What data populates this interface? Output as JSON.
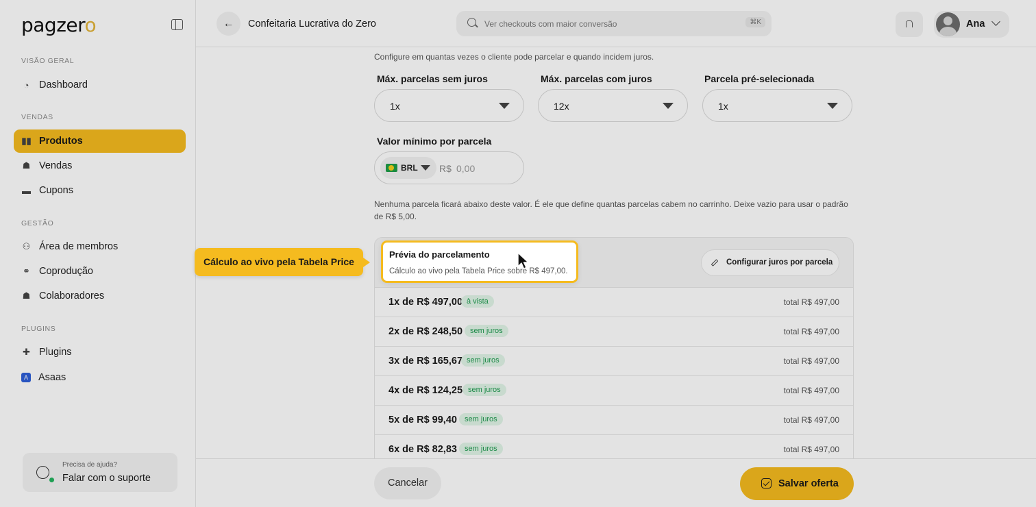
{
  "sidebar": {
    "logo_text": "pagzer",
    "logo_accent": "o",
    "sections": [
      {
        "title": "VISÃO GERAL"
      },
      {
        "title": "VENDAS"
      },
      {
        "title": "GESTÃO"
      },
      {
        "title": "PLUGINS"
      }
    ],
    "items": [
      {
        "label": "Dashboard",
        "icon": "dashboard-icon"
      },
      {
        "label": "Produtos",
        "icon": "box-icon",
        "active": true
      },
      {
        "label": "Vendas",
        "icon": "sales-icon"
      },
      {
        "label": "Cupons",
        "icon": "coupon-icon"
      },
      {
        "label": "Área de membros",
        "icon": "members-icon"
      },
      {
        "label": "Coprodução",
        "icon": "handshake-icon"
      },
      {
        "label": "Colaboradores",
        "icon": "user-icon"
      },
      {
        "label": "Plugins",
        "icon": "puzzle-icon"
      },
      {
        "label": "Asaas",
        "icon": "asaas-icon"
      }
    ],
    "help": {
      "small": "Precisa de ajuda?",
      "big": "Falar com o suporte"
    }
  },
  "header": {
    "title": "Confeitaria Lucrativa do Zero",
    "search_placeholder": "Ver checkouts com maior conversão",
    "search_shortcut": "⌘K",
    "user_name": "Ana"
  },
  "form": {
    "description": "Configure em quantas vezes o cliente pode parcelar e quando incidem juros.",
    "fields": [
      {
        "label": "Máx. parcelas sem juros",
        "value": "1x"
      },
      {
        "label": "Máx. parcelas com juros",
        "value": "12x"
      },
      {
        "label": "Parcela pré-selecionada",
        "value": "1x"
      }
    ],
    "min_value": {
      "label": "Valor mínimo por parcela",
      "currency": "BRL",
      "prefix": "R$",
      "placeholder": "0,00"
    },
    "hint": "Nenhuma parcela ficará abaixo deste valor. É ele que define quantas parcelas cabem no carrinho. Deixe vazio para usar o padrão de R$ 5,00."
  },
  "preview": {
    "title": "Prévia do parcelamento",
    "subtitle": "Cálculo ao vivo pela Tabela Price sobre R$ 497,00.",
    "config_button": "Configurar juros por parcela",
    "rows": [
      {
        "installment": "1x de R$ 497,00",
        "badge": "à vista",
        "total": "total R$ 497,00"
      },
      {
        "installment": "2x de R$ 248,50",
        "badge": "sem juros",
        "total": "total R$ 497,00"
      },
      {
        "installment": "3x de R$ 165,67",
        "badge": "sem juros",
        "total": "total R$ 497,00"
      },
      {
        "installment": "4x de R$ 124,25",
        "badge": "sem juros",
        "total": "total R$ 497,00"
      },
      {
        "installment": "5x de R$ 99,40",
        "badge": "sem juros",
        "total": "total R$ 497,00"
      },
      {
        "installment": "6x de R$ 82,83",
        "badge": "sem juros",
        "total": "total R$ 497,00"
      }
    ]
  },
  "footer": {
    "cancel": "Cancelar",
    "save": "Salvar oferta"
  },
  "tour": {
    "tooltip": "Cálculo ao vivo pela Tabela Price"
  },
  "colors": {
    "accent": "#f5bb1f",
    "success": "#1d9a4e"
  }
}
